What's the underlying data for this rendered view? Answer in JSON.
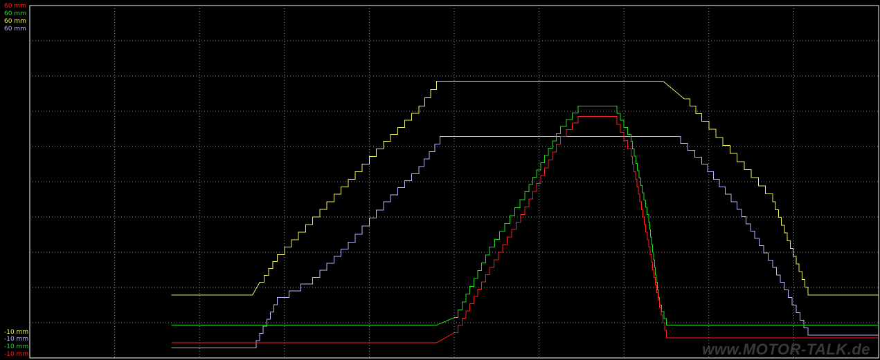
{
  "chart_data": {
    "type": "line",
    "background": "#000000",
    "grid": "dotted",
    "x_range": [
      0,
      24
    ],
    "y_range": [
      -10,
      60
    ],
    "y_labels_top": [
      {
        "text": "60 mm",
        "color": "#ff2020"
      },
      {
        "text": "60 mm",
        "color": "#20e020"
      },
      {
        "text": "60 mm",
        "color": "#f0f060"
      },
      {
        "text": "60 mm",
        "color": "#b8b8ff"
      }
    ],
    "y_labels_bottom": [
      {
        "text": "-10 mm",
        "color": "#f0f060"
      },
      {
        "text": "-10 mm",
        "color": "#b8b8ff"
      },
      {
        "text": "-10 mm",
        "color": "#20e020"
      },
      {
        "text": "-10 mm",
        "color": "#ff2020"
      }
    ],
    "series": [
      {
        "color": "#f0f060",
        "x": [
          4.0,
          6.3,
          6.5,
          7.0,
          8.0,
          9.0,
          10.0,
          11.0,
          11.5,
          17.9,
          18.5,
          19.0,
          20.0,
          21.0,
          22.0,
          24.0
        ],
        "y": [
          2.5,
          2.5,
          5.0,
          10.5,
          18.0,
          25.5,
          33.0,
          40.0,
          45.0,
          45.0,
          41.5,
          37.0,
          29.0,
          21.0,
          2.5,
          2.5
        ]
      },
      {
        "color": "#b8b8ff",
        "x": [
          4.0,
          6.3,
          7.0,
          8.0,
          9.0,
          10.0,
          11.0,
          11.6,
          18.2,
          19.0,
          20.0,
          21.0,
          22.0,
          24.0
        ],
        "y": [
          -8.0,
          -8.0,
          2.0,
          6.0,
          13.0,
          21.0,
          28.0,
          34.0,
          34.0,
          28.5,
          19.5,
          8.0,
          -5.5,
          -5.5
        ]
      },
      {
        "color": "#20e020",
        "x": [
          4.0,
          11.5,
          12.0,
          13.0,
          14.0,
          15.0,
          15.5,
          16.5,
          17.0,
          17.5,
          17.8,
          18.0,
          24.0
        ],
        "y": [
          -3.5,
          -3.5,
          -2.0,
          12.0,
          23.0,
          36.0,
          40.0,
          40.0,
          33.0,
          17.0,
          0.5,
          -3.5,
          -3.5
        ]
      },
      {
        "color": "#ff2020",
        "x": [
          4.0,
          11.5,
          12.0,
          13.0,
          14.0,
          15.0,
          15.5,
          16.5,
          17.0,
          17.5,
          17.8,
          18.0,
          24.0
        ],
        "y": [
          -7.0,
          -7.0,
          -5.0,
          8.0,
          20.0,
          34.0,
          38.0,
          38.0,
          30.0,
          12.0,
          0.0,
          -6.0,
          -6.0
        ]
      }
    ]
  },
  "watermark": "www.MOTOR-TALK.de"
}
